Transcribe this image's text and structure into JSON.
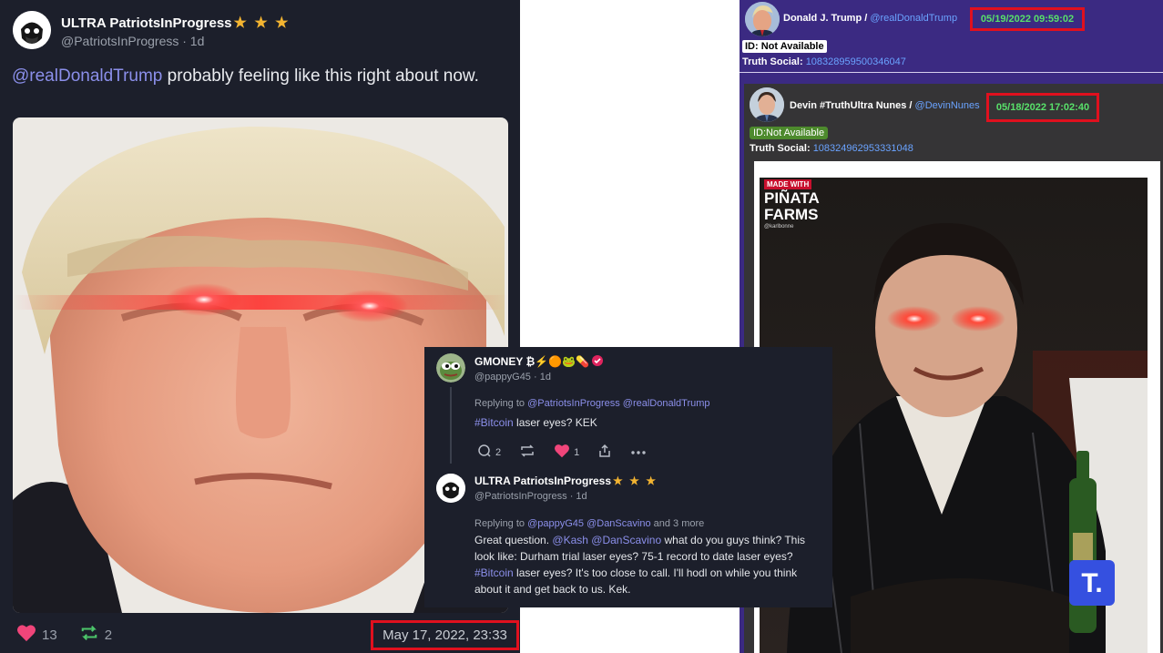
{
  "left_post": {
    "display_name": "ULTRA PatriotsInProgress",
    "stars": "★ ★ ★",
    "handle": "@PatriotsInProgress · 1d",
    "mention": "@realDonaldTrump",
    "text": " probably feeling like this right about now.",
    "likes": "13",
    "reposts": "2",
    "date": "May 17, 2022, 23:33"
  },
  "reply_card": {
    "reply1": {
      "display_name": "GMONEY ₿⚡🟠🐸💊",
      "handle": "@pappyG45 · 1d",
      "replying_label": "Replying to ",
      "replying_to": "@PatriotsInProgress @realDonaldTrump",
      "hashtag": "#Bitcoin",
      "body": " laser eyes? KEK",
      "comments": "2",
      "likes": "1"
    },
    "reply2": {
      "display_name": "ULTRA PatriotsInProgress",
      "stars": "★ ★ ★",
      "handle": "@PatriotsInProgress · 1d",
      "replying_label": "Replying to ",
      "replying_to": "@pappyG45 @DanScavino",
      "replying_more": " and 3 more",
      "body_1": "Great question. ",
      "mentions": "@Kash @DanScavino",
      "body_2": " what do you guys think? This look like: Durham trial laser eyes? 75-1 record to date laser eyes? ",
      "hashtag": "#Bitcoin",
      "body_3": " laser eyes? It's too close to call. I'll hodl on while you think about it and get back to us. Kek."
    }
  },
  "right_panel": {
    "top": {
      "name": "Donald J. Trump / ",
      "handle": "@realDonaldTrump",
      "timestamp": "05/19/2022 09:59:02",
      "id_badge": "ID: Not Available",
      "truth_label": "Truth Social: ",
      "truth_id": "108328959500346047"
    },
    "inner": {
      "name": "Devin #TruthUltra Nunes / ",
      "handle": "@DevinNunes",
      "timestamp": "05/18/2022 17:02:40",
      "id_badge": "ID:Not Available",
      "truth_label": "Truth Social: ",
      "truth_id": "108324962953331048",
      "meme_tag": "MADE WITH",
      "meme_brand_1": "PIÑATA",
      "meme_brand_2": "FARMS",
      "meme_credit": "@karlbonne",
      "meme_logo": "T."
    }
  },
  "colors": {
    "left_bg": "#1c1f2b",
    "right_bg": "#3b2a82",
    "highlight_box": "#e0101e",
    "timestamp_green": "#58e06a",
    "mention": "#8b8fea",
    "like_pink": "#f0457a",
    "repost_green": "#4cc56a"
  },
  "icons": [
    "heart-icon",
    "repost-icon",
    "comment-icon",
    "share-icon",
    "more-icon",
    "verified-icon"
  ]
}
